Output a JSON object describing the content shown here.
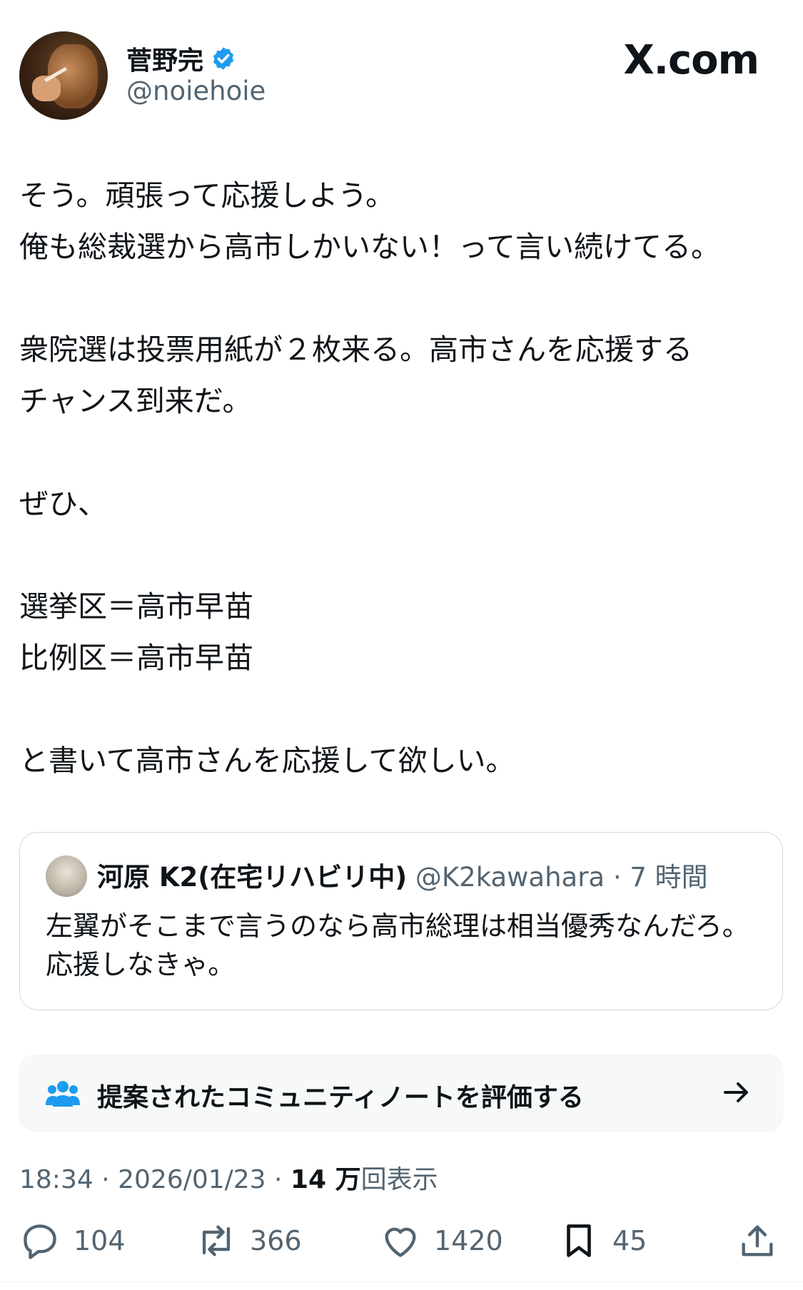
{
  "author": {
    "name": "菅野完",
    "handle": "@noiehoie",
    "verified": true
  },
  "site_label": "X.com",
  "tweet_lines": [
    "そう。頑張って応援しよう。",
    "俺も総裁選から高市しかいない！って言い続けてる。",
    "",
    "衆院選は投票用紙が２枚来る。高市さんを応援する",
    "チャンス到来だ。",
    "",
    "ぜひ、",
    "",
    "選挙区＝高市早苗",
    "比例区＝高市早苗",
    "",
    "と書いて高市さんを応援して欲しい。"
  ],
  "quote": {
    "name": "河原 K2(在宅リハビリ中)",
    "handle": "@K2kawahara",
    "time": "· 7 時間",
    "text": "左翼がそこまで言うのなら高市総理は相当優秀なんだろ。応援しなきゃ。"
  },
  "community_note": {
    "label": "提案されたコミュニティノートを評価する"
  },
  "meta": {
    "time": "18:34",
    "sep1": " · ",
    "date": "2026/01/23",
    "sep2": " · ",
    "views_value": "14 万",
    "views_label": "回表示"
  },
  "actions": {
    "replies": "104",
    "reposts": "366",
    "likes": "1420",
    "bookmarks": "45"
  },
  "colors": {
    "verified": "#1d9bf0",
    "secondary_text": "#536471",
    "primary_text": "#0f1419",
    "community_icon": "#1d9bf0"
  }
}
